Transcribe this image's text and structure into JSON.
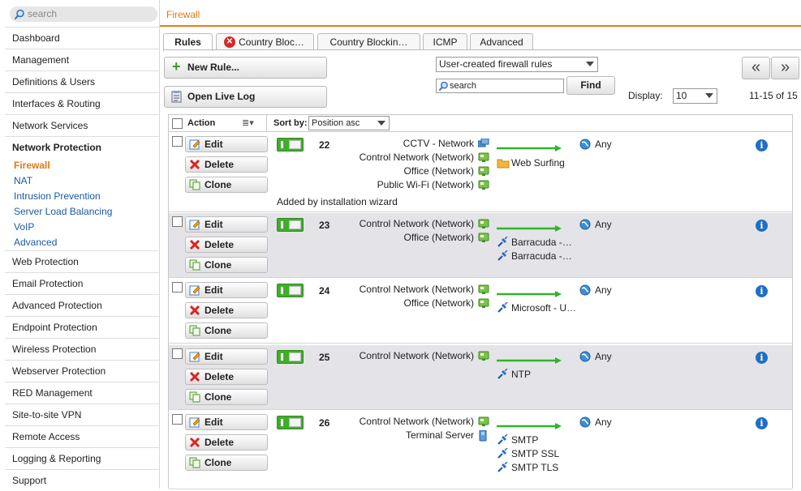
{
  "sidebar": {
    "search_placeholder": "search",
    "items": [
      {
        "label": "Dashboard",
        "key": "dashboard"
      },
      {
        "label": "Management",
        "key": "management"
      },
      {
        "label": "Definitions & Users",
        "key": "definitions-users"
      },
      {
        "label": "Interfaces & Routing",
        "key": "interfaces-routing"
      },
      {
        "label": "Network Services",
        "key": "network-services"
      },
      {
        "label": "Network Protection",
        "key": "network-protection"
      }
    ],
    "sub_items": [
      {
        "label": "Firewall",
        "active": true
      },
      {
        "label": "NAT"
      },
      {
        "label": "Intrusion Prevention"
      },
      {
        "label": "Server Load Balancing"
      },
      {
        "label": "VoIP"
      },
      {
        "label": "Advanced"
      }
    ],
    "items_after": [
      {
        "label": "Web Protection"
      },
      {
        "label": "Email Protection"
      },
      {
        "label": "Advanced Protection"
      },
      {
        "label": "Endpoint Protection"
      },
      {
        "label": "Wireless Protection"
      },
      {
        "label": "Webserver Protection"
      },
      {
        "label": "RED Management"
      },
      {
        "label": "Site-to-site VPN"
      },
      {
        "label": "Remote Access"
      },
      {
        "label": "Logging & Reporting"
      },
      {
        "label": "Support"
      }
    ]
  },
  "header": {
    "title": "Firewall"
  },
  "tabs": [
    {
      "label": "Rules"
    },
    {
      "label": "Country Bloc…"
    },
    {
      "label": "Country Blockin…"
    },
    {
      "label": "ICMP"
    },
    {
      "label": "Advanced"
    }
  ],
  "toolbar": {
    "new_rule": "New Rule...",
    "open_live_log": "Open Live Log",
    "filter_select": "User-created firewall rules",
    "search_placeholder": "search",
    "find": "Find",
    "display_label": "Display:",
    "display_value": "10",
    "range": "11-15 of 15",
    "prev": "«",
    "next": "»"
  },
  "grid": {
    "action_header": "Action",
    "sort_label": "Sort by:",
    "sort_value": "Position asc",
    "edit": "Edit",
    "delete": "Delete",
    "clone": "Clone"
  },
  "rules": [
    {
      "num": "22",
      "sources": [
        "CCTV - Network",
        "Control Network (Network)",
        "Office (Network)",
        "Public Wi-Fi (Network)"
      ],
      "services": [
        "Web Surfing"
      ],
      "dest": "Any",
      "note": "Added by installation wizard"
    },
    {
      "num": "23",
      "sources": [
        "Control Network (Network)",
        "Office (Network)"
      ],
      "services": [
        "Barracuda -…",
        "Barracuda -…"
      ],
      "dest": "Any",
      "note": ""
    },
    {
      "num": "24",
      "sources": [
        "Control Network (Network)",
        "Office (Network)"
      ],
      "services": [
        "Microsoft - U…"
      ],
      "dest": "Any",
      "note": ""
    },
    {
      "num": "25",
      "sources": [
        "Control Network (Network)"
      ],
      "services": [
        "NTP"
      ],
      "dest": "Any",
      "note": ""
    },
    {
      "num": "26",
      "sources": [
        "Control Network (Network)",
        "Terminal Server"
      ],
      "services": [
        "SMTP",
        "SMTP SSL",
        "SMTP TLS"
      ],
      "dest": "Any",
      "note": ""
    }
  ],
  "colors": {
    "accent": "#e87c14",
    "link": "#1a5aa6",
    "toggle_on": "#3fae2a"
  }
}
